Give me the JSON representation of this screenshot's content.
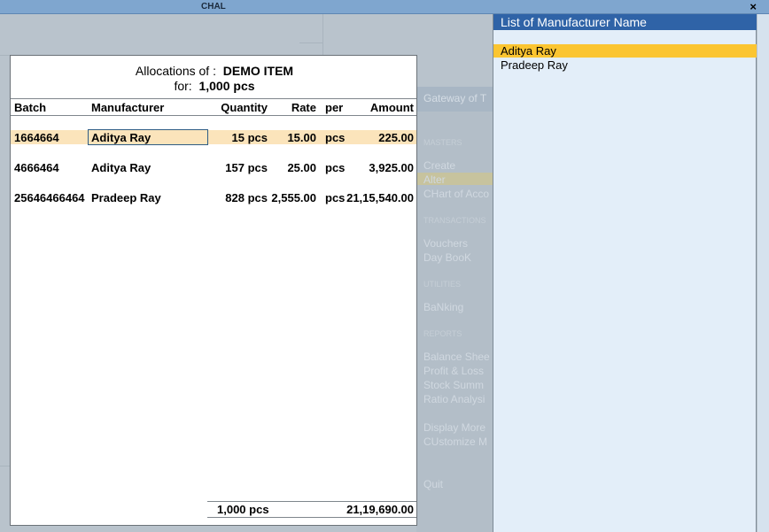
{
  "window": {
    "title": "CHAL",
    "close_glyph": "×"
  },
  "gateway": {
    "title": "Gateway of T",
    "sections": [
      {
        "heading": "MASTERS",
        "items": [
          "Create",
          "Alter",
          "CHart of Acco"
        ]
      },
      {
        "heading": "TRANSACTIONS",
        "items": [
          "Vouchers",
          "Day BooK"
        ]
      },
      {
        "heading": "UTILITIES",
        "items": [
          "BaNking"
        ]
      },
      {
        "heading": "REPORTS",
        "items": [
          "Balance Shee",
          "Profit & Loss",
          "Stock Summ",
          "Ratio Analysi"
        ]
      },
      {
        "heading": "",
        "items": [
          "Display More",
          "CUstomize M"
        ]
      },
      {
        "heading": "",
        "items": [
          "Quit"
        ]
      }
    ]
  },
  "allocations": {
    "title_label": "Allocations of :",
    "item_name": "DEMO ITEM",
    "for_label": "for:",
    "for_qty": "1,000 pcs",
    "columns": {
      "batch": "Batch",
      "manufacturer": "Manufacturer",
      "quantity": "Quantity",
      "rate": "Rate",
      "per": "per",
      "amount": "Amount"
    },
    "rows": [
      {
        "batch": "1664664",
        "manufacturer": "Aditya Ray",
        "quantity": "15 pcs",
        "rate": "15.00",
        "per": "pcs",
        "amount": "225.00"
      },
      {
        "batch": "4666464",
        "manufacturer": "Aditya Ray",
        "quantity": "157 pcs",
        "rate": "25.00",
        "per": "pcs",
        "amount": "3,925.00"
      },
      {
        "batch": "25646466464",
        "manufacturer": "Pradeep Ray",
        "quantity": "828 pcs",
        "rate": "2,555.00",
        "per": "pcs",
        "amount": "21,15,540.00"
      }
    ],
    "total_quantity": "1,000 pcs",
    "total_amount": "21,19,690.00"
  },
  "manufacturer_list": {
    "title": "List of Manufacturer Name",
    "items": [
      "Aditya Ray",
      "Pradeep Ray"
    ]
  },
  "colors": {
    "accent": "#2f63a7",
    "highlight": "#fbc531",
    "selected_row": "#fbe4bb"
  }
}
